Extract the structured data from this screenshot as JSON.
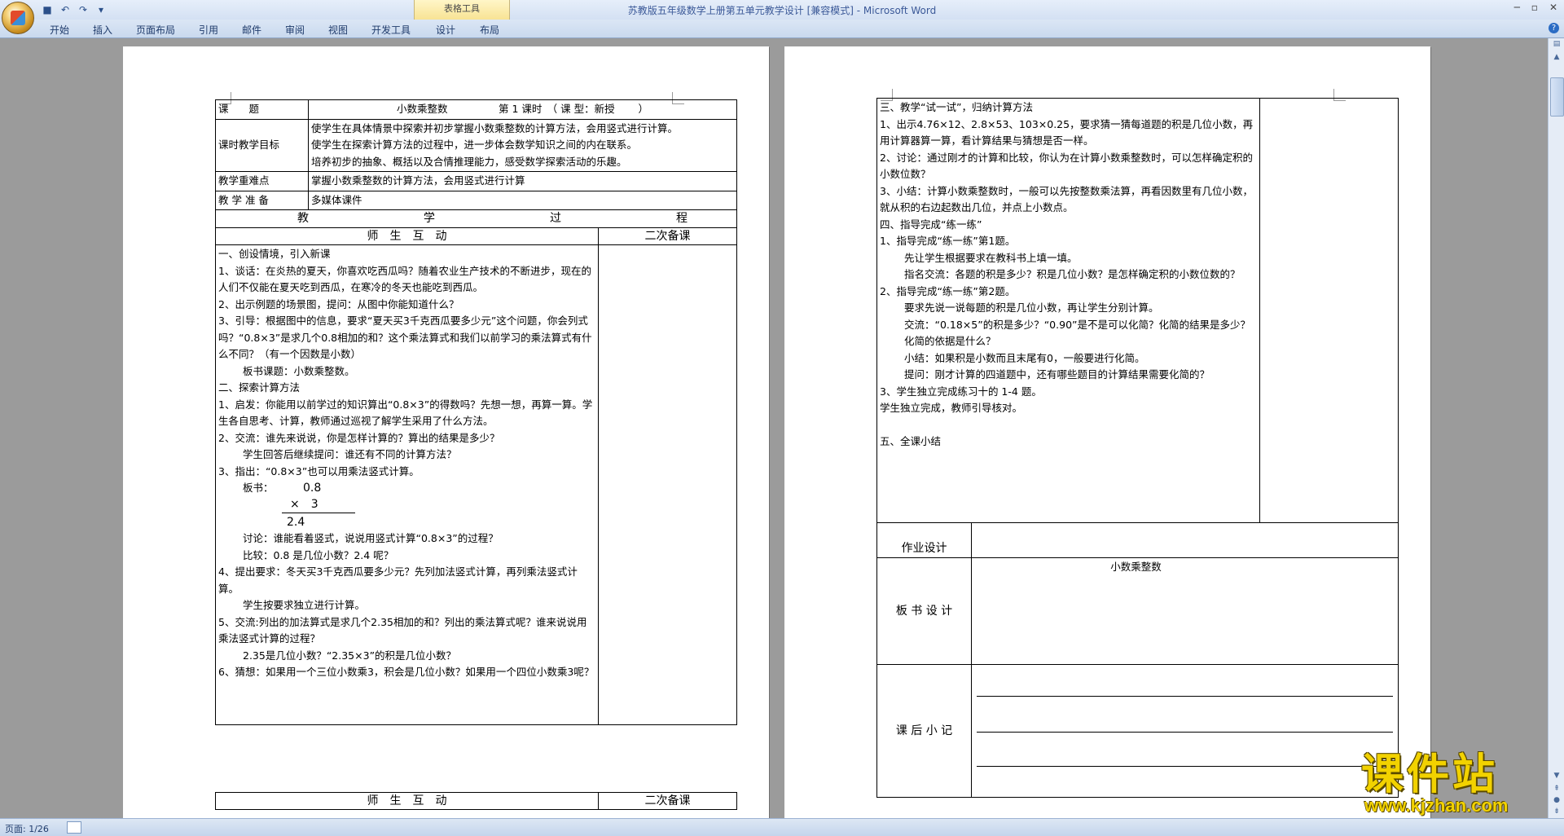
{
  "window": {
    "title": "苏教版五年级数学上册第五单元教学设计 [兼容模式] - Microsoft Word",
    "context_tab_group": "表格工具"
  },
  "ribbon": {
    "tabs": [
      "开始",
      "插入",
      "页面布局",
      "引用",
      "邮件",
      "审阅",
      "视图",
      "开发工具",
      "设计",
      "布局"
    ]
  },
  "status": {
    "page": "页面: 1/26"
  },
  "watermark": {
    "text": "课件站",
    "url": "www.kjzhan.com"
  },
  "page1": {
    "lesson_label": "课　　题",
    "lesson_value": "小数乘整数　　　　　第 1 课时　（ 课 型：新授　　 ）",
    "goals_label": "课时教学目标",
    "goals": [
      "使学生在具体情景中探索并初步掌握小数乘整数的计算方法，会用竖式进行计算。",
      "使学生在探索计算方法的过程中，进一步体会数学知识之间的内在联系。",
      "培养初步的抽象、概括以及合情推理能力，感受数学探索活动的乐趣。"
    ],
    "keypoint_label": "教学重难点",
    "keypoint_value": "掌握小数乘整数的计算方法，会用竖式进行计算",
    "prep_label": "教 学 准 备",
    "prep_value": "多媒体课件",
    "process_chars": [
      "教",
      "学",
      "过",
      "程"
    ],
    "col_left": "师　生　互　动",
    "col_right": "二次备课",
    "lines": [
      "一、创设情境，引入新课",
      "1、谈话：在炎热的夏天，你喜欢吃西瓜吗？随着农业生产技术的不断进步，现在的人们不仅能在夏天吃到西瓜，在寒冷的冬天也能吃到西瓜。",
      "2、出示例题的场景图，提问：从图中你能知道什么？",
      "3、引导：根据图中的信息，要求“夏天买3千克西瓜要多少元”这个问题，你会列式吗？“0.8×3”是求几个0.8相加的和？这个乘法算式和我们以前学习的乘法算式有什么不同？（有一个因数是小数）",
      "板书课题：小数乘整数。",
      "二、探索计算方法",
      "1、启发：你能用以前学过的知识算出“0.8×3”的得数吗？先想一想，再算一算。学生各自思考、计算，教师通过巡视了解学生采用了什么方法。",
      "2、交流：谁先来说说，你是怎样计算的？算出的结果是多少？",
      "学生回答后继续提问：谁还有不同的计算方法？",
      "3、指出：“0.8×3”也可以用乘法竖式计算。"
    ],
    "vertical_calc": {
      "label": "板书：",
      "top": "0.8",
      "mid": "×　3",
      "result": "2.4"
    },
    "lines2": [
      "讨论：谁能看着竖式，说说用竖式计算“0.8×3”的过程？",
      "比较：0.8 是几位小数？2.4 呢？",
      "4、提出要求：冬天买3千克西瓜要多少元？先列加法竖式计算，再列乘法竖式计算。",
      "学生按要求独立进行计算。",
      "5、交流:列出的加法算式是求几个2.35相加的和？列出的乘法算式呢？谁来说说用乘法竖式计算的过程？",
      "2.35是几位小数？“2.35×3”的积是几位小数？",
      "6、猜想：如果用一个三位小数乘3，积会是几位小数？如果用一个四位小数乘3呢？"
    ],
    "footer_left": "师　生　互　动",
    "footer_right": "二次备课"
  },
  "page2": {
    "lines": [
      "三、教学“试一试”，归纳计算方法",
      "1、出示4.76×12、2.8×53、103×0.25，要求猜一猜每道题的积是几位小数，再用计算器算一算，看计算结果与猜想是否一样。",
      "2、讨论：通过刚才的计算和比较，你认为在计算小数乘整数时，可以怎样确定积的小数位数？",
      "3、小结：计算小数乘整数时，一般可以先按整数乘法算，再看因数里有几位小数，就从积的右边起数出几位，并点上小数点。",
      "四、指导完成“练一练”",
      "1、指导完成“练一练”第1题。",
      "先让学生根据要求在教科书上填一填。",
      "指名交流：各题的积是多少？积是几位小数？是怎样确定积的小数位数的？",
      "2、指导完成“练一练”第2题。",
      "要求先说一说每题的积是几位小数，再让学生分别计算。",
      "交流：“0.18×5”的积是多少？“0.90”是不是可以化简？化简的结果是多少？化简的依据是什么？",
      "小结：如果积是小数而且末尾有0，一般要进行化简。",
      "提问：刚才计算的四道题中，还有哪些题目的计算结果需要化简的？",
      "3、学生独立完成练习十的 1-4 题。",
      "学生独立完成，教师引导核对。",
      "",
      "五、全课小结"
    ],
    "homework_label": "作业设计",
    "board_label": "板 书 设 计",
    "board_title": "小数乘整数",
    "notes_label": "课 后 小 记"
  }
}
